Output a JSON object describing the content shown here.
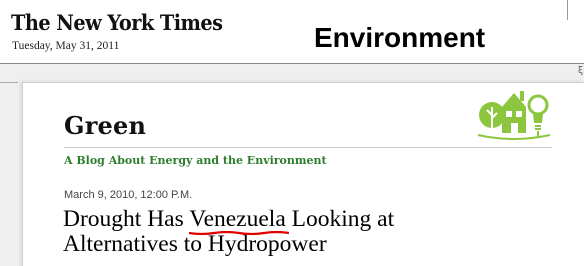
{
  "header": {
    "masthead": "The New York Times",
    "date": "Tuesday, May 31, 2011",
    "section": "Environment",
    "right_mark": "ξ"
  },
  "blog": {
    "title": "Green",
    "subtitle": "A Blog About Energy and the Environment",
    "logo_icon": "green-house-lightbulb-logo-icon",
    "accent_color": "#2d7d2d",
    "logo_color": "#8cc63f"
  },
  "post": {
    "timestamp": "March 9, 2010, 12:00 P.M.",
    "headline_before": "Drought Has ",
    "headline_highlight": "Venezuela",
    "headline_after": " Looking at",
    "headline_line2": "Alternatives to Hydropower",
    "highlight_underline_color": "#e00000"
  }
}
